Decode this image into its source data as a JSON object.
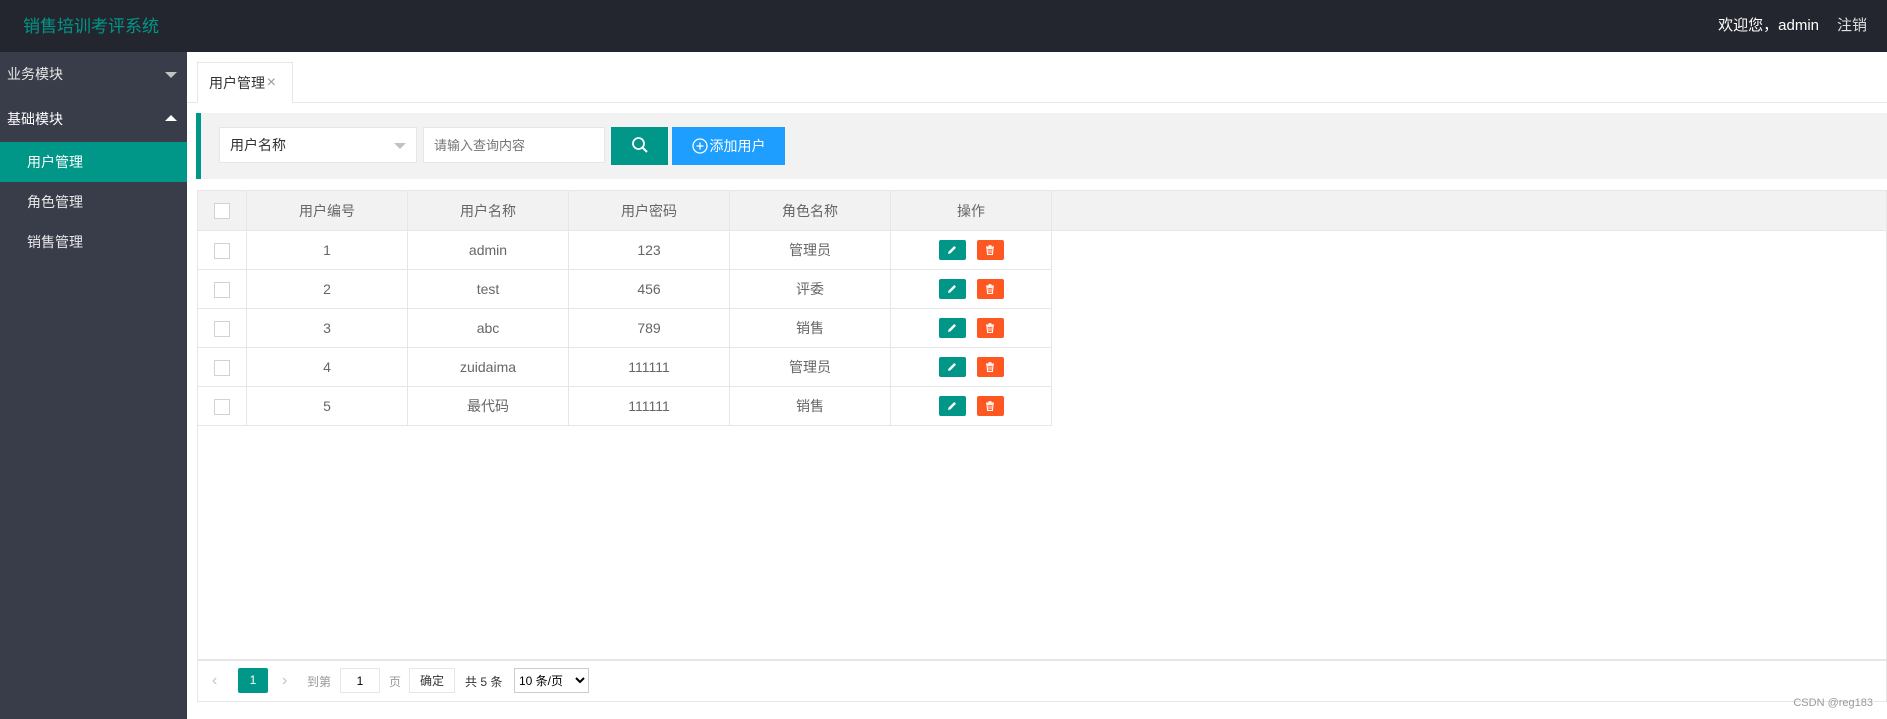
{
  "header": {
    "title": "销售培训考评系统",
    "welcome": "欢迎您，admin",
    "logout": "注销"
  },
  "sidebar": {
    "groups": [
      {
        "label": "业务模块",
        "expanded": false
      },
      {
        "label": "基础模块",
        "expanded": true
      }
    ],
    "items": [
      {
        "label": "用户管理",
        "active": true
      },
      {
        "label": "角色管理",
        "active": false
      },
      {
        "label": "销售管理",
        "active": false
      }
    ]
  },
  "tabs": [
    {
      "label": "用户管理"
    }
  ],
  "toolbar": {
    "select_value": "用户名称",
    "search_placeholder": "请输入查询内容",
    "add_label": "添加用户"
  },
  "table": {
    "headers": [
      "用户编号",
      "用户名称",
      "用户密码",
      "角色名称",
      "操作"
    ],
    "rows": [
      [
        "1",
        "admin",
        "123",
        "管理员"
      ],
      [
        "2",
        "test",
        "456",
        "评委"
      ],
      [
        "3",
        "abc",
        "789",
        "销售"
      ],
      [
        "4",
        "zuidaima",
        "111111",
        "管理员"
      ],
      [
        "5",
        "最代码",
        "111111",
        "销售"
      ]
    ]
  },
  "pagination": {
    "current": "1",
    "goto_label": "到第",
    "goto_value": "1",
    "page_label": "页",
    "confirm": "确定",
    "total": "共 5 条",
    "page_size": "10 条/页"
  },
  "watermark": "CSDN @reg183",
  "colors": {
    "header_bg": "#23262e",
    "sidebar_bg": "#393d49",
    "accent": "#009688",
    "primary": "#1e9fff",
    "danger": "#ff5722"
  },
  "icons": [
    "chevron-down-icon",
    "chevron-up-icon",
    "close-icon",
    "search-icon",
    "add-circle-icon",
    "edit-icon",
    "trash-icon"
  ]
}
